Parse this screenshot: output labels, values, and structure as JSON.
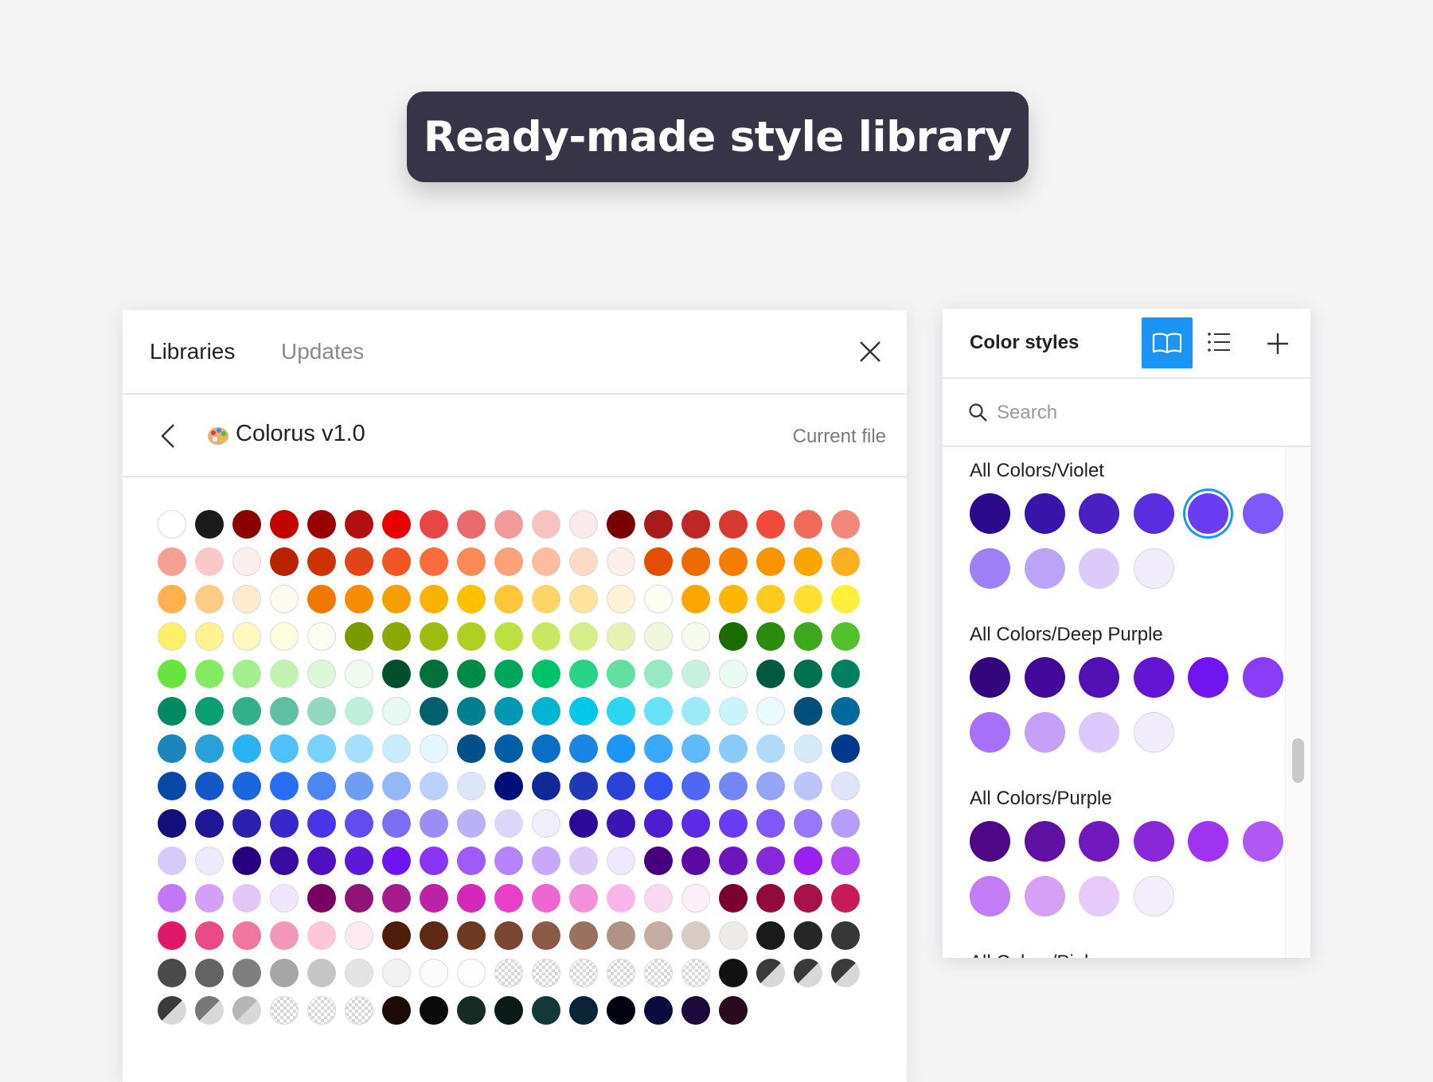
{
  "banner": {
    "title": "Ready-made style library"
  },
  "libraries_panel": {
    "tabs": [
      "Libraries",
      "Updates"
    ],
    "library_name": "Colorus v1.0",
    "current_file_label": "Current file",
    "swatches": [
      [
        "#ffffff",
        "#1a1a1a",
        "#8b0000",
        "#c40000",
        "#990000",
        "#b01010",
        "#e60000",
        "#e84545",
        "#e96a6a",
        "#f09a9a",
        "#f7c2c2",
        "#fbeaea",
        "#7a0000",
        "#a81b1b",
        "#bf2626",
        "#d83a30",
        "#f04a3a",
        "#f06a5a",
        "#f2887a"
      ],
      [
        "#f4a193",
        "#fbc8c8",
        "#fdeeee",
        "#b82200",
        "#cc3300",
        "#e04418",
        "#f05522",
        "#fa6d3a",
        "#fa8a55",
        "#fba27a",
        "#fcbca0",
        "#fdd9c8",
        "#fcefe9",
        "#e24f00",
        "#ed6a00",
        "#f57e00",
        "#f79400",
        "#faa600",
        "#fbb022"
      ],
      [
        "#fdb24f",
        "#fdcb85",
        "#feeacc",
        "#fdfbef",
        "#f07800",
        "#f78d00",
        "#f5a000",
        "#fab200",
        "#fcc000",
        "#fcc838",
        "#fdd466",
        "#fee39b",
        "#fdf2d3",
        "#fdfdf0",
        "#fca600",
        "#fdb700",
        "#fdcb20",
        "#fee030",
        "#ffee3a"
      ],
      [
        "#fff066",
        "#fff38f",
        "#fff8c1",
        "#fdfde0",
        "#fbfdf0",
        "#7a9a00",
        "#8aa800",
        "#9cbc10",
        "#aed021",
        "#bce040",
        "#c9e860",
        "#d6ee88",
        "#e4f3b2",
        "#eef6dc",
        "#f6fbee",
        "#1a6b00",
        "#2c8a10",
        "#3ca81c",
        "#52c22c"
      ],
      [
        "#66e53c",
        "#84ea62",
        "#a2ef8c",
        "#c0f3b2",
        "#dcf7d6",
        "#f0fbf0",
        "#00502c",
        "#00703a",
        "#008a48",
        "#00a65a",
        "#00c268",
        "#26d488",
        "#62e0a2",
        "#96e9c2",
        "#c4f2dd",
        "#eafbf4",
        "#005a40",
        "#00704f",
        "#008060"
      ],
      [
        "#008a64",
        "#0a9e70",
        "#32b088",
        "#5ec0a0",
        "#92d8c0",
        "#c0eedc",
        "#e6f9f2",
        "#00606e",
        "#00808e",
        "#0098b0",
        "#00b4d2",
        "#00c8e8",
        "#2cd6f0",
        "#68e2f6",
        "#9aeaf8",
        "#c8f4fc",
        "#eafbfe",
        "#004f7a",
        "#006a9c"
      ],
      [
        "#1a86bc",
        "#2aa0d8",
        "#28b2f2",
        "#4cc2f8",
        "#78d2fa",
        "#a4e0fc",
        "#c8edfe",
        "#e6f6fe",
        "#00508a",
        "#005ea6",
        "#0a6ec6",
        "#1a86e4",
        "#1a96f6",
        "#3aa8f8",
        "#60baf8",
        "#8acaf8",
        "#b0daf8",
        "#d6ebfa",
        "#003a8a"
      ],
      [
        "#0a48a6",
        "#1258c8",
        "#1a66e0",
        "#286ef2",
        "#4a86f4",
        "#6e9ef4",
        "#94b8f6",
        "#bad0f8",
        "#dce6fa",
        "#000e7a",
        "#0f2996",
        "#1e38b8",
        "#2a42d8",
        "#3450f0",
        "#4e68f4",
        "#7286f4",
        "#96a4f6",
        "#bcc4f8",
        "#e0e4fa"
      ],
      [
        "#14107a",
        "#1e1696",
        "#2a20b0",
        "#3828cc",
        "#4a34e8",
        "#604cf0",
        "#7c6ef2",
        "#9a8ef4",
        "#bab0f6",
        "#dcd6fa",
        "#f0eefc",
        "#2a0a96",
        "#3c14b4",
        "#4c1ed0",
        "#5c2be8",
        "#6a3cf6",
        "#8058f8",
        "#9878f8",
        "#b49cf8"
      ],
      [
        "#d6cbf8",
        "#eeeafd",
        "#260080",
        "#380ca0",
        "#4c10bc",
        "#5e18d8",
        "#6e14f2",
        "#8a34f6",
        "#a05af8",
        "#b484f8",
        "#c8a8f8",
        "#dccbfa",
        "#efe8fd",
        "#46007e",
        "#5a0aa0",
        "#6e16be",
        "#8628d8",
        "#9a20f0",
        "#b048f2"
      ],
      [
        "#c278f4",
        "#d4a0f6",
        "#e2c6f8",
        "#f0e6fc",
        "#780060",
        "#8e1478",
        "#a41c8e",
        "#bc22a4",
        "#d428b8",
        "#e83ec8",
        "#ee66d2",
        "#f290dc",
        "#f6b6e8",
        "#fad8f2",
        "#fdeefa",
        "#7a0030",
        "#920a3c",
        "#a8124a",
        "#c81a5a"
      ],
      [
        "#e0186a",
        "#ea4a86",
        "#f078a0",
        "#f498ba",
        "#fac6d8",
        "#fdeaf0",
        "#4e1c08",
        "#5e2814",
        "#6c3820",
        "#7a4630",
        "#8a5a46",
        "#9a705e",
        "#b09286",
        "#c4aca2",
        "#d8cac4",
        "#ecebea",
        "#1a1a1a",
        "#262626",
        "#363636"
      ],
      [
        "#4a4a4a",
        "#636363",
        "#7e7e7e",
        "#a6a6a6",
        "#c6c6c6",
        "#e4e4e4",
        "#f2f2f2",
        "#fbfbfb",
        "#fefefe",
        "clear",
        "clear",
        "clear",
        "clear",
        "clear",
        "clear",
        "#111111",
        "clear-dark",
        "clear-dark",
        "clear-dark"
      ],
      [
        "clear-dark",
        "clear-mid",
        "clear-light",
        "clear",
        "clear",
        "clear",
        "#1c0a06",
        "#0a0a0a",
        "#152b24",
        "#0a1a16",
        "#133838",
        "#0a2436",
        "#040410",
        "#0a0a3c",
        "#1c0a3c",
        "#2a0a1e"
      ]
    ]
  },
  "color_styles_panel": {
    "title": "Color styles",
    "toolbar_icons": [
      "book-icon",
      "list-icon",
      "plus-icon"
    ],
    "search": {
      "placeholder": "Search",
      "value": ""
    },
    "groups": [
      {
        "label": "All Colors/Violet",
        "colors": [
          "#2c0a8c",
          "#3814a8",
          "#4a20c2",
          "#5a2ee0",
          "#6a3cf4",
          "#7e58f8",
          "#9e80f8",
          "#bba4f8",
          "#dccbfa",
          "#f0ecfc"
        ],
        "selected_index": 4
      },
      {
        "label": "All Colors/Deep Purple",
        "colors": [
          "#34067e",
          "#42089a",
          "#5210b4",
          "#6216d2",
          "#7014f0",
          "#8a3cf8",
          "#a870f8",
          "#c49ef8",
          "#dcc8fa",
          "#f0ecfc"
        ],
        "selected_index": null
      },
      {
        "label": "All Colors/Purple",
        "colors": [
          "#4e0886",
          "#5e10a0",
          "#7018bc",
          "#8828d8",
          "#a032f2",
          "#b058f4",
          "#c47cf6",
          "#d6a0f6",
          "#e8cafa",
          "#f4eefc"
        ],
        "selected_index": null
      }
    ],
    "next_group_label": "All Colors/Pink"
  }
}
